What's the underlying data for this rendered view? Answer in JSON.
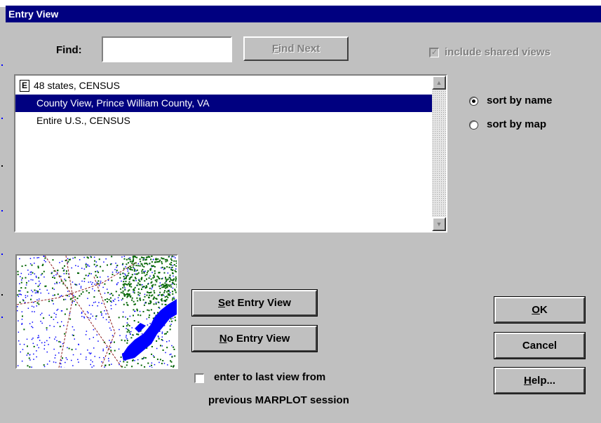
{
  "dialog": {
    "title": "Entry View"
  },
  "find": {
    "label": "Find:",
    "value": "",
    "find_next": {
      "pre": "",
      "ul": "F",
      "post": "ind Next"
    }
  },
  "include_shared": {
    "label": "include shared views",
    "checked": true,
    "enabled": false
  },
  "views_list": {
    "items": [
      {
        "label": "48 states, CENSUS",
        "badge": "E",
        "selected": false
      },
      {
        "label": "County View, Prince William County, VA",
        "badge": "",
        "selected": true
      },
      {
        "label": "Entire U.S., CENSUS",
        "badge": "",
        "selected": false
      }
    ]
  },
  "sort": {
    "by_name": {
      "label": "sort by name",
      "selected": true
    },
    "by_map": {
      "label": "sort by map",
      "selected": false
    }
  },
  "buttons": {
    "set_entry": {
      "pre": "",
      "ul": "S",
      "post": "et Entry View"
    },
    "no_entry": {
      "pre": "",
      "ul": "N",
      "post": "o Entry View"
    },
    "ok": {
      "pre": "",
      "ul": "O",
      "post": "K"
    },
    "cancel": {
      "pre": "Cancel",
      "ul": "",
      "post": ""
    },
    "help": {
      "pre": "",
      "ul": "H",
      "post": "elp..."
    }
  },
  "last_view": {
    "line1": "enter to last view from",
    "line2": "previous MARPLOT session",
    "checked": false
  },
  "colors": {
    "title_bg": "#000080",
    "selection_bg": "#000080",
    "face": "#c0c0c0",
    "map_water": "#0000ff",
    "map_forest": "#006400",
    "map_roads": "#8b1a1a"
  },
  "icons": {
    "e_badge": "entry-view-marker-icon",
    "scroll_up": "triangle-up-icon",
    "scroll_down": "triangle-down-icon",
    "checkmark": "checkmark-icon"
  }
}
